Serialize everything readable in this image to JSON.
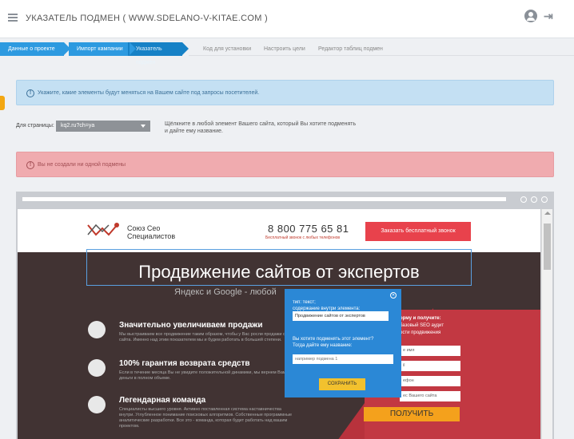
{
  "header": {
    "title": "УКАЗАТЕЛЬ ПОДМЕН ( WWW.SDELANO-V-KITAE.COM )",
    "icons": [
      "menu-icon",
      "user-icon",
      "logout-icon"
    ]
  },
  "steps": [
    {
      "label": "Данные о проекте",
      "state": "done"
    },
    {
      "label": "Импорт кампании",
      "state": "done"
    },
    {
      "label": "Указатель подмен",
      "state": "current"
    },
    {
      "label": "Код для установки",
      "state": "todo"
    },
    {
      "label": "Настроить цели",
      "state": "todo"
    },
    {
      "label": "Редактор таблиц подмен",
      "state": "todo"
    }
  ],
  "info_alert": "Укажите, какие элементы будут меняться на Вашем сайте под запросы посетителей.",
  "page_select": {
    "label": "Для страницы:",
    "value": "kq2.ru?ch=ya"
  },
  "hint": "Щёлкните в любой элемент Вашего сайта, который Вы хотите подменять и дайте ему название.",
  "error_alert": "Вы не создали ни одной подмены",
  "site": {
    "brand_line1": "Союз Сео",
    "brand_line2": "Специалистов",
    "phone": "8 800 775 65 81",
    "phone_note": "Бесплатный звонок с любых телефонов",
    "call_button": "Заказать бесплатный звонок",
    "headline": "Продвижение сайтов от экспертов",
    "subheadline": "Яндекс и Google - любой",
    "features": [
      {
        "icon": "money-bag-icon",
        "title": "Значительно увеличиваем продажи",
        "text": "Мы выстраиваем все продвижение таким образом, чтобы у Вас росли продажи с сайта. Именно над этим показателем мы и будем работать в большей степени."
      },
      {
        "icon": "badge-100-icon",
        "title": "100% гарантия возврата средств",
        "text": "Если в течение месяца Вы не увидите положительной динамики, мы вернем Вам деньги в полном объеме."
      },
      {
        "icon": "team-icon",
        "title": "Легендарная команда",
        "text": "Специалисты высшего уровня. Активно поставленная система наставничества внутри. Углубленное понимание поисковых алгоритмов. Собственные программные аналитические разработки. Все это - команда, которая будет работать над вашим проектом."
      }
    ],
    "form_texts": [
      "орму и получите:",
      "базовый SEO аудит",
      "ости продвижения"
    ],
    "form_inputs": [
      "е имя",
      "il",
      "ефон",
      "ес Вашего сайта"
    ],
    "get_button": "ПОЛУЧИТЬ"
  },
  "popup": {
    "type_line": "тип: текст;",
    "content_label": "содержание внутри элемента:",
    "content_value": "Продвижение сайтов от экспертов",
    "question": "Вы хотите подменять этот элемент?",
    "question2": "Тогда дайте ему название:",
    "name_placeholder": "например подмена 1",
    "save_button": "СОХРАНИТЬ"
  }
}
